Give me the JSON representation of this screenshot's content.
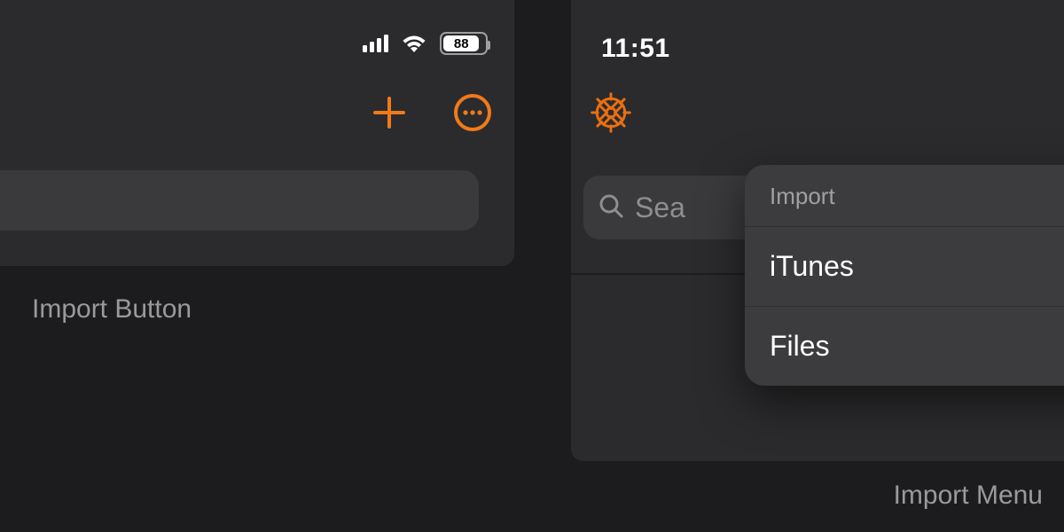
{
  "accent": "#f07a1a",
  "left": {
    "caption": "Import Button",
    "status": {
      "battery_percent": "88",
      "battery_fill_pct": 88
    },
    "toolbar": {
      "add_icon": "plus-icon",
      "more_icon": "more-icon"
    },
    "search_placeholder": ""
  },
  "right": {
    "caption": "Import Menu",
    "status": {
      "time": "11:51"
    },
    "toolbar": {
      "settings_icon": "gear-icon"
    },
    "search_placeholder": "Sea",
    "menu": {
      "title": "Import",
      "items": [
        "iTunes",
        "Files"
      ]
    }
  }
}
